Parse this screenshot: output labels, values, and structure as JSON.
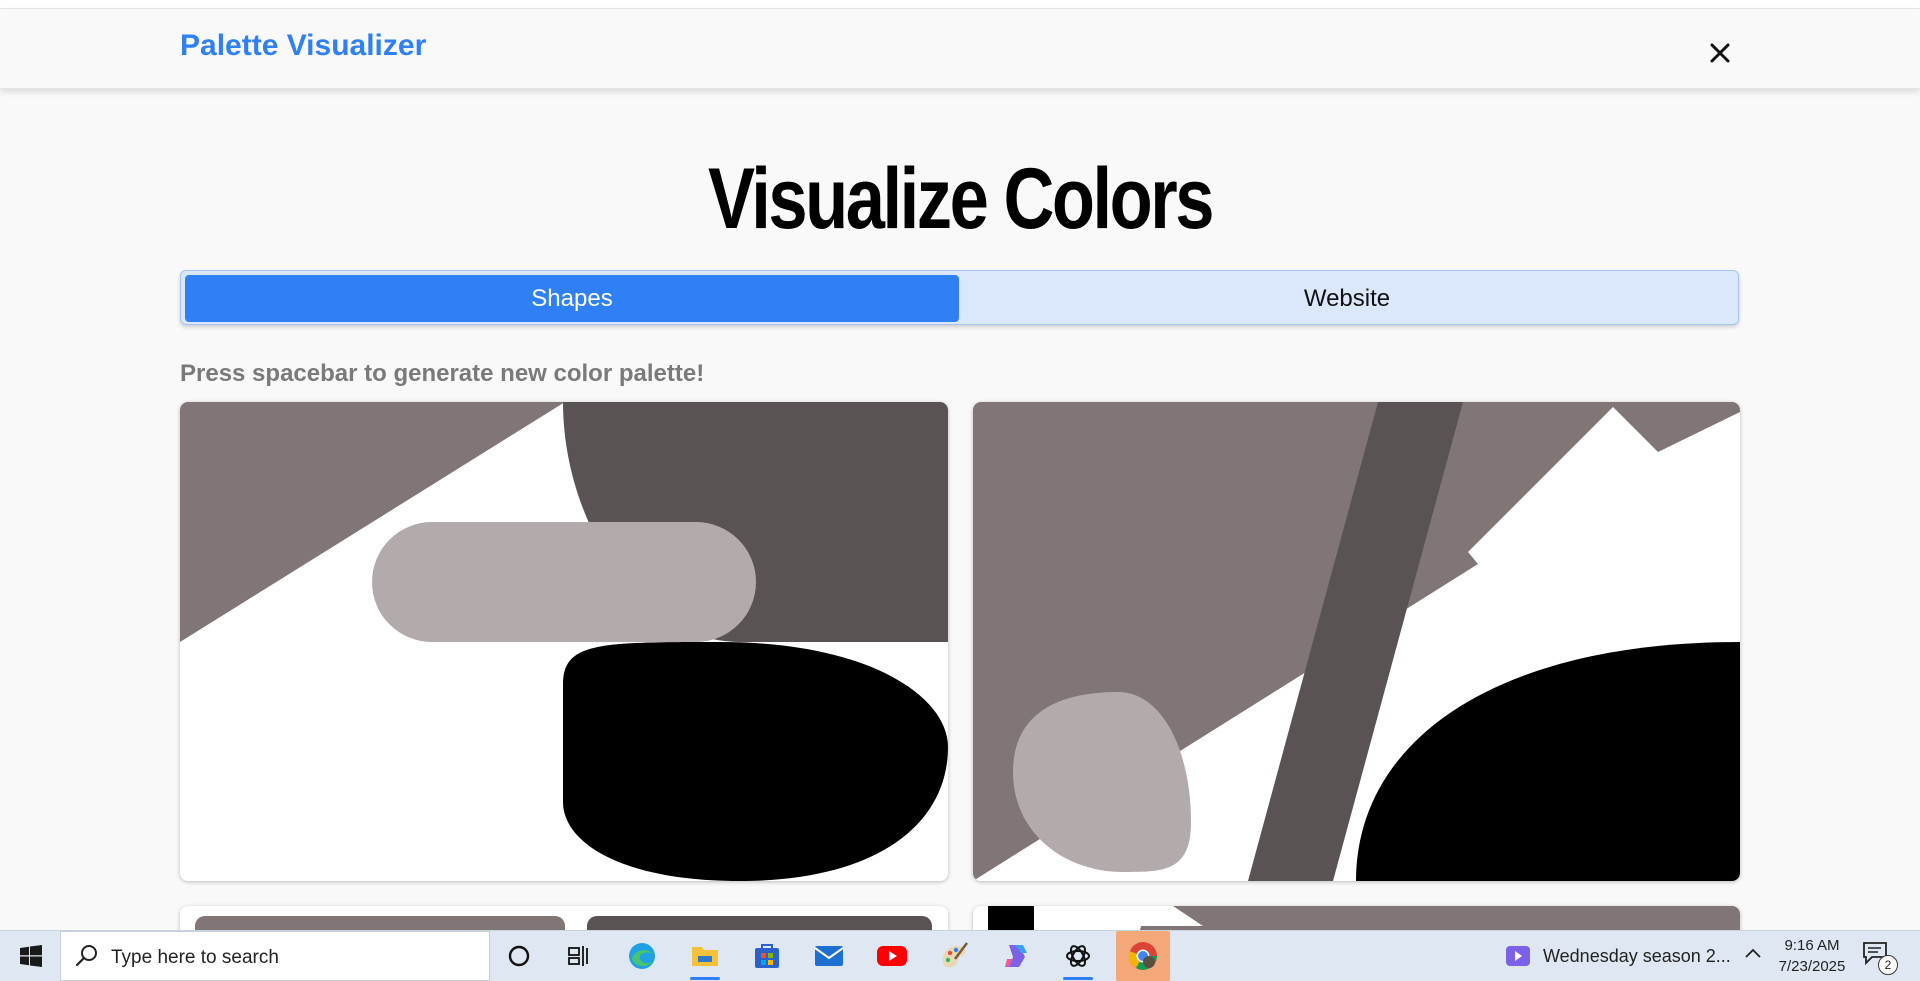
{
  "app": {
    "brand": "Palette Visualizer",
    "close_label": "×"
  },
  "hero": {
    "title": "Visualize Colors"
  },
  "tabs": [
    {
      "label": "Shapes",
      "active": true
    },
    {
      "label": "Website",
      "active": false
    }
  ],
  "hint": "Press spacebar to generate new color palette!",
  "palette": {
    "colors": [
      "#807676",
      "#5a5353",
      "#b3aaab",
      "#000000",
      "#ffffff"
    ],
    "accent": "#2f80f5"
  },
  "taskbar": {
    "search_placeholder": "Type here to search",
    "pinned_icons": [
      "cortana-icon",
      "task-view-icon",
      "edge-icon",
      "file-explorer-icon",
      "store-icon",
      "mail-icon",
      "youtube-icon",
      "paint-icon",
      "copilot-icon",
      "chatgpt-icon",
      "chrome-icon"
    ],
    "notification": "Wednesday season 2...",
    "time": "9:16 AM",
    "date": "7/23/2025",
    "notification_count": "2"
  }
}
